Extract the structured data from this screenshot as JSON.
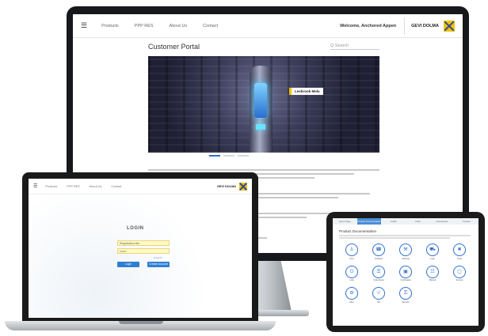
{
  "desktop": {
    "nav": {
      "menu_icon": "menu-icon",
      "links": [
        "Products",
        "PPP RES",
        "About Us",
        "Contact"
      ],
      "welcome": "Welcome, Anchored Appen",
      "brand": "GEVI DOLMA"
    },
    "title": "Customer Portal",
    "search_placeholder": "Q  Search",
    "hero_badge": "Lesbrook Mela"
  },
  "laptop": {
    "nav": {
      "links": [
        "Products",
        "PPP RES",
        "About Us",
        "Contact"
      ],
      "brand": "GEVI DOLMA"
    },
    "login_title": "LOGIN",
    "username_value": "Registration site",
    "password_value": "•••••••",
    "forgot_link": "Forgot?",
    "buttons": [
      "Login",
      "Create Account"
    ]
  },
  "tablet": {
    "tabs": [
      "Home Page",
      "Product Documentation",
      "Install",
      "Order",
      "Accessories",
      "Contact"
    ],
    "title": "Product Documentation",
    "icons": [
      {
        "icon": "person-icon",
        "glyph": "♙",
        "label": "User"
      },
      {
        "icon": "phone-icon",
        "glyph": "☎",
        "label": "Software"
      },
      {
        "icon": "tools-icon",
        "glyph": "⚒",
        "label": "Settings"
      },
      {
        "icon": "truck-icon",
        "glyph": "⛟",
        "label": "Logo"
      },
      {
        "icon": "cross-tools-icon",
        "glyph": "✖",
        "label": "Tools"
      },
      {
        "icon": "power-icon",
        "glyph": "⏻",
        "label": "Lock"
      },
      {
        "icon": "layers-icon",
        "glyph": "☰",
        "label": "Instructions"
      },
      {
        "icon": "cube-icon",
        "glyph": "▣",
        "label": "Certificates"
      },
      {
        "icon": "document-icon",
        "glyph": "☷",
        "label": "Manual"
      },
      {
        "icon": "box-icon",
        "glyph": "▢",
        "label": "Service"
      },
      {
        "icon": "gear-icon",
        "glyph": "⚙",
        "label": "Misc"
      },
      {
        "icon": "globe-icon",
        "glyph": "☉",
        "label": "Net"
      },
      {
        "icon": "lock-icon",
        "glyph": "⚿",
        "label": "Security"
      }
    ]
  },
  "colors": {
    "accent": "#2f6fd1",
    "brand_yellow": "#f2c200",
    "brand_blue": "#2d4a9c"
  }
}
